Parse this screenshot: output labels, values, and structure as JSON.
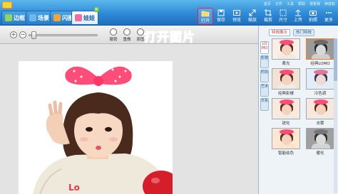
{
  "tabs": [
    {
      "label": "边框",
      "icon": "frame-icon",
      "color": "#8fd45c"
    },
    {
      "label": "场景",
      "icon": "scene-icon",
      "color": "#6db7f0"
    },
    {
      "label": "闪图",
      "icon": "flash-icon",
      "color": "#f6a23a"
    },
    {
      "label": "娃娃",
      "icon": "doll-icon",
      "color": "#f26ea2",
      "badge": "新"
    }
  ],
  "menu": [
    "首页",
    "文件",
    "工具",
    "帮助",
    "很累我",
    "换皮肤"
  ],
  "toolbar": [
    {
      "label": "打开",
      "icon": "folder-open-icon",
      "highlight": true
    },
    {
      "label": "保存",
      "icon": "save-icon"
    },
    {
      "label": "预览",
      "icon": "preview-icon"
    },
    {
      "label": "缩放",
      "icon": "resize-icon"
    },
    {
      "label": "裁剪",
      "icon": "crop-icon"
    },
    {
      "label": "尺寸",
      "icon": "size-icon"
    },
    {
      "label": "上传",
      "icon": "upload-icon"
    },
    {
      "label": "拍照",
      "icon": "camera-icon"
    },
    {
      "label": "更多",
      "icon": "more-icon"
    }
  ],
  "subbar": {
    "undo": "撤销",
    "redo": "重做",
    "reset": "原图"
  },
  "callout": "打开图片",
  "panel": {
    "tabs": [
      "特效展示",
      "热门特效"
    ],
    "categories": [
      "LOMO",
      "影楼",
      "时尚",
      "艺术",
      "日系"
    ],
    "thumbs": [
      {
        "label": "柔光"
      },
      {
        "label": "经典LOMO",
        "selected": true
      },
      {
        "label": "经典影楼"
      },
      {
        "label": "冷色调"
      },
      {
        "label": "锐化"
      },
      {
        "label": "去雾"
      },
      {
        "label": "智能绘色"
      },
      {
        "label": "暖化"
      }
    ]
  },
  "colors": {
    "topbar": "#2f8ad6",
    "highlight": "#e21f4d",
    "callout": "#ff2f67"
  }
}
